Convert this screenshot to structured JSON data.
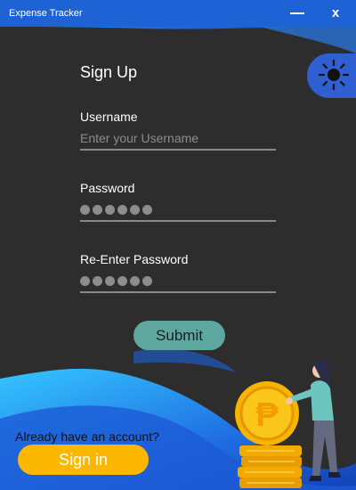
{
  "window": {
    "title": "Expense Tracker",
    "minimize_label": "—",
    "close_label": "x"
  },
  "form": {
    "heading": "Sign Up",
    "username": {
      "label": "Username",
      "placeholder": "Enter your Username",
      "value": ""
    },
    "password": {
      "label": "Password",
      "masked_length": 6
    },
    "reenter_password": {
      "label": "Re-Enter Password",
      "masked_length": 6
    },
    "submit_label": "Submit"
  },
  "footer": {
    "prompt": "Already have an account?",
    "signin_label": "Sign in"
  },
  "icons": {
    "theme_toggle": "sun-icon",
    "illustration": "person-coins-illustration"
  },
  "colors": {
    "background": "#2d2d2d",
    "accent_blue": "#1e63d6",
    "submit": "#5fa8a2",
    "signin": "#fcb700",
    "coin": "#f7b500"
  }
}
